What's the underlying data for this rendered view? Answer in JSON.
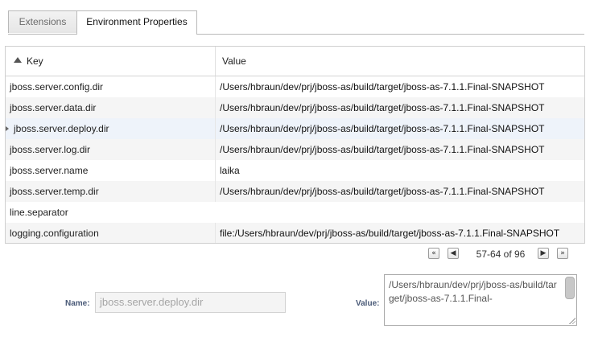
{
  "tabs": [
    {
      "label": "Extensions",
      "active": false
    },
    {
      "label": "Environment Properties",
      "active": true
    }
  ],
  "table": {
    "columns": [
      "Key",
      "Value"
    ],
    "sort": {
      "column": "Key",
      "direction": "ascending"
    },
    "rows": [
      {
        "key": "jboss.server.config.dir",
        "value": "/Users/hbraun/dev/prj/jboss-as/build/target/jboss-as-7.1.1.Final-SNAPSHOT"
      },
      {
        "key": "jboss.server.data.dir",
        "value": "/Users/hbraun/dev/prj/jboss-as/build/target/jboss-as-7.1.1.Final-SNAPSHOT"
      },
      {
        "key": "jboss.server.deploy.dir",
        "value": "/Users/hbraun/dev/prj/jboss-as/build/target/jboss-as-7.1.1.Final-SNAPSHOT",
        "selected": true
      },
      {
        "key": "jboss.server.log.dir",
        "value": "/Users/hbraun/dev/prj/jboss-as/build/target/jboss-as-7.1.1.Final-SNAPSHOT"
      },
      {
        "key": "jboss.server.name",
        "value": "laika"
      },
      {
        "key": "jboss.server.temp.dir",
        "value": "/Users/hbraun/dev/prj/jboss-as/build/target/jboss-as-7.1.1.Final-SNAPSHOT"
      },
      {
        "key": "line.separator",
        "value": ""
      },
      {
        "key": "logging.configuration",
        "value": "file:/Users/hbraun/dev/prj/jboss-as/build/target/jboss-as-7.1.1.Final-SNAPSHOT"
      }
    ]
  },
  "pager": {
    "first_icon": "first-page-icon",
    "prev_icon": "prev-page-icon",
    "next_icon": "next-page-icon",
    "last_icon": "last-page-icon",
    "info": "57-64 of 96"
  },
  "detail": {
    "name_label": "Name:",
    "name_value": "jboss.server.deploy.dir",
    "value_label": "Value:",
    "value_text": "/Users/hbraun/dev/prj/jboss-as/build/target/jboss-as-7.1.1.Final-"
  }
}
